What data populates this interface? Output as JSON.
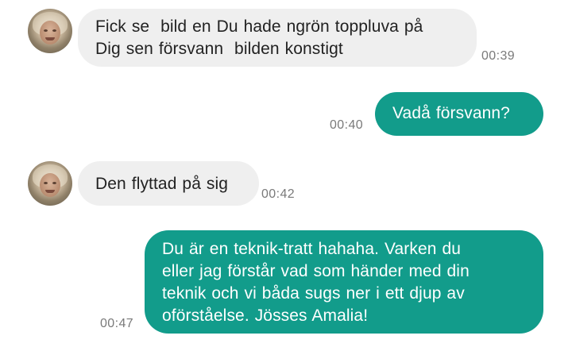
{
  "conversation": {
    "messages": [
      {
        "direction": "incoming",
        "lines": [
          "Fick se  bild en Du hade ngrön toppluva på",
          "Dig sen försvann  bilden konstigt"
        ],
        "time": "00:39"
      },
      {
        "direction": "outgoing",
        "lines": [
          "Vadå försvann?"
        ],
        "time": "00:40"
      },
      {
        "direction": "incoming",
        "lines": [
          "Den flyttad på sig"
        ],
        "time": "00:42"
      },
      {
        "direction": "outgoing",
        "lines": [
          "Du är en teknik-tratt hahaha. Varken du",
          "eller jag förstår vad som händer med din",
          "teknik och vi båda sugs ner i ett djup av",
          "oförståelse. Jösses Amalia!"
        ],
        "time": "00:47"
      }
    ]
  },
  "colors": {
    "incoming_bubble": "#efefef",
    "outgoing_bubble": "#129c8b",
    "outgoing_text": "#ffffff",
    "timestamp": "#7a7a7a"
  },
  "icons": {
    "avatar": "contact-avatar"
  }
}
